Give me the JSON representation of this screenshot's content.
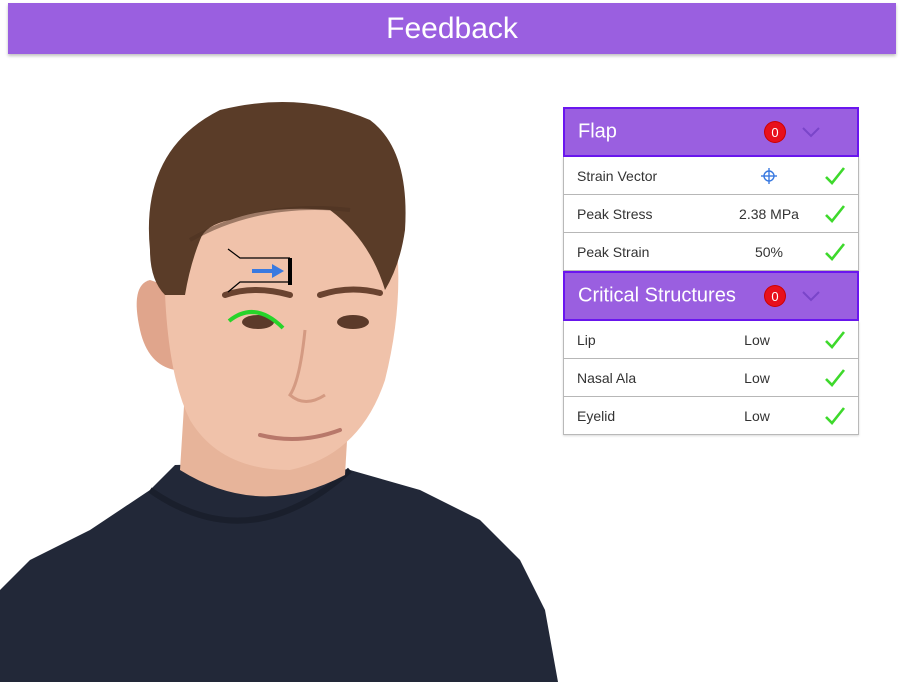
{
  "title": "Feedback",
  "panel": {
    "sections": [
      {
        "label": "Flap",
        "badge": "0",
        "rows": [
          {
            "name": "Strain Vector",
            "value": "",
            "value_icon": "crosshair-icon",
            "status_icon": "checkmark-icon"
          },
          {
            "name": "Peak Stress",
            "value": "2.38 MPa",
            "status_icon": "checkmark-icon"
          },
          {
            "name": "Peak Strain",
            "value": "50%",
            "status_icon": "checkmark-icon"
          }
        ]
      },
      {
        "label": "Critical Structures",
        "badge": "0",
        "rows": [
          {
            "name": "Lip",
            "value": "Low",
            "status_icon": "checkmark-icon"
          },
          {
            "name": "Nasal Ala",
            "value": "Low",
            "status_icon": "checkmark-icon"
          },
          {
            "name": "Eyelid",
            "value": "Low",
            "status_icon": "checkmark-icon"
          }
        ]
      }
    ]
  },
  "colors": {
    "header": "#9a5fe0",
    "header_border": "#6a16ef",
    "badge": "#e8101c",
    "check": "#3ed92c",
    "vector_arrow": "#3a7ae0",
    "eyelid_arc": "#27d42a"
  }
}
